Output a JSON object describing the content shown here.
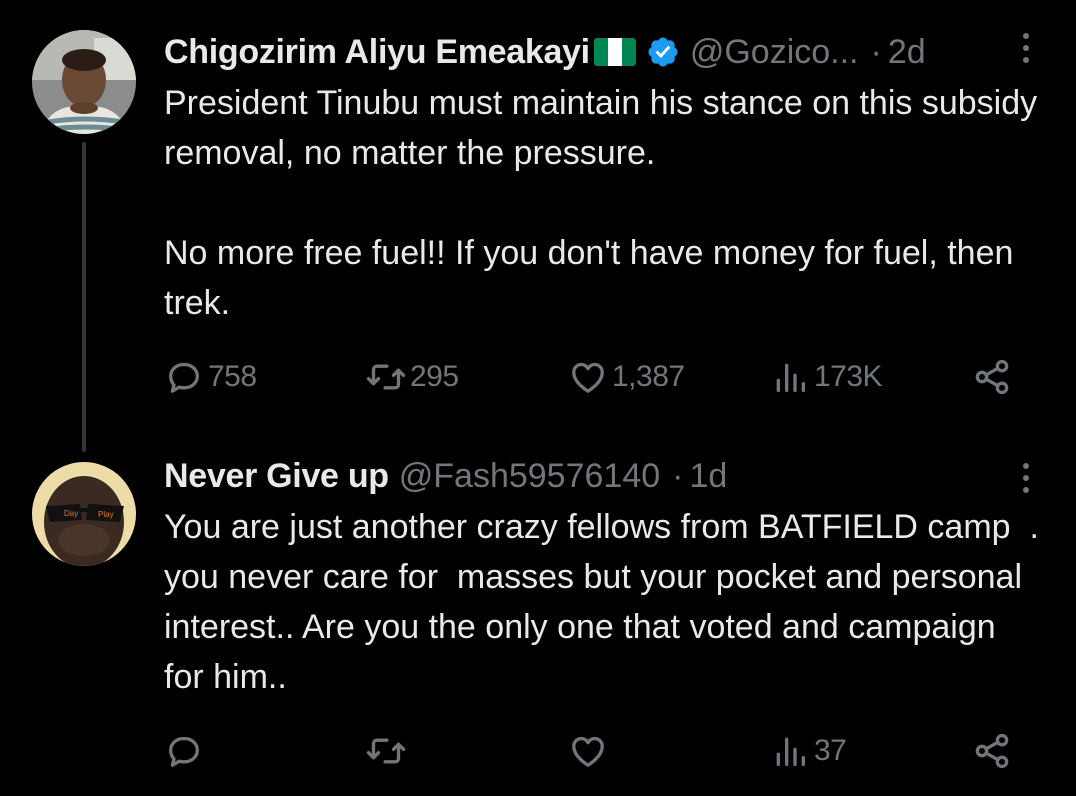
{
  "tweets": [
    {
      "display_name": "Chigozirim Aliyu Emeakayi",
      "handle": "@Gozico...",
      "separator": "·",
      "time": "2d",
      "text": "President Tinubu must maintain his stance on this subsidy removal, no matter the pressure.\n\nNo more free fuel!! If you don't have money for fuel, then trek.",
      "replies": "758",
      "reposts": "295",
      "likes": "1,387",
      "views": "173K",
      "has_flag": true,
      "verified": true
    },
    {
      "display_name": "Never Give up",
      "handle": "@Fash59576140",
      "separator": "·",
      "time": "1d",
      "text": "You are just another crazy fellows from BATFIELD camp  . you never care for  masses but your pocket and personal interest.. Are you the only one that voted and campaign for him..",
      "replies": "",
      "reposts": "",
      "likes": "",
      "views": "37",
      "has_flag": false,
      "verified": false,
      "avatar_sunglasses_text": [
        "Day",
        "Play"
      ]
    }
  ],
  "icons": {
    "reply": "reply-icon",
    "repost": "repost-icon",
    "like": "like-icon",
    "views": "views-icon",
    "share": "share-icon",
    "more": "more-icon",
    "verified": "verified-badge-icon",
    "flag": "nigeria-flag-icon"
  },
  "colors": {
    "background": "#000000",
    "text": "#e7e9ea",
    "muted": "#71767b",
    "verified": "#1d9bf0",
    "thread_line": "#333639",
    "flag_green": "#008751",
    "flag_white": "#ffffff"
  }
}
